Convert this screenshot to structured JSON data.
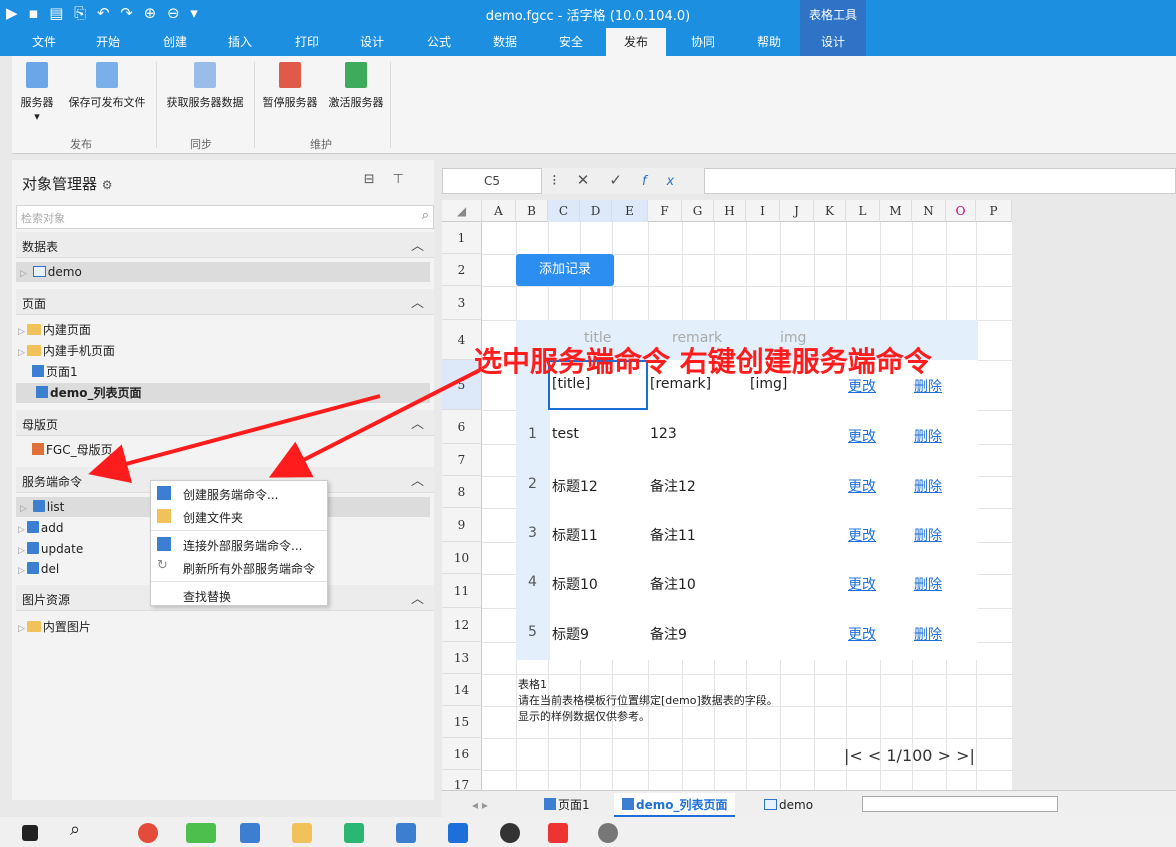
{
  "window": {
    "title": "demo.fgcc - 活字格 (10.0.104.0)",
    "ctx_group": "表格工具"
  },
  "ribbon": {
    "tabs": [
      "文件",
      "开始",
      "创建",
      "插入",
      "打印",
      "设计",
      "公式",
      "数据",
      "安全",
      "发布",
      "协同",
      "帮助"
    ],
    "active_tab": "发布",
    "ctx_tab": "设计",
    "buttons": {
      "server": "服务器",
      "save_publish": "保存可发布文件",
      "fetch": "获取服务器数据",
      "pause": "暂停服务器",
      "activate": "激活服务器"
    },
    "groups": {
      "publish": "发布",
      "sync": "同步",
      "maintain": "维护"
    }
  },
  "object_manager": {
    "title": "对象管理器",
    "search_placeholder": "检索对象",
    "sections": {
      "tables": {
        "label": "数据表",
        "items": [
          "demo"
        ]
      },
      "pages": {
        "label": "页面",
        "items": [
          "内建页面",
          "内建手机页面",
          "页面1",
          "demo_列表页面"
        ]
      },
      "master": {
        "label": "母版页",
        "items": [
          "FGC_母版页"
        ]
      },
      "server_cmd": {
        "label": "服务端命令",
        "items": [
          "list",
          "add",
          "update",
          "del"
        ]
      },
      "images": {
        "label": "图片资源",
        "items": [
          "内置图片"
        ]
      }
    }
  },
  "context_menu": {
    "items": [
      "创建服务端命令...",
      "创建文件夹",
      "连接外部服务端命令...",
      "刷新所有外部服务端命令",
      "查找替换"
    ]
  },
  "formula_bar": {
    "cell_ref": "C5",
    "fx": "fx"
  },
  "sheet": {
    "columns": [
      "A",
      "B",
      "C",
      "D",
      "E",
      "F",
      "G",
      "H",
      "I",
      "J",
      "K",
      "L",
      "M",
      "N",
      "O",
      "P"
    ],
    "rows": [
      "1",
      "2",
      "3",
      "4",
      "5",
      "6",
      "7",
      "8",
      "9",
      "10",
      "11",
      "12",
      "13",
      "14",
      "15",
      "16",
      "17"
    ],
    "add_button": "添加记录",
    "table": {
      "headers": [
        "title",
        "remark",
        "img"
      ],
      "template": [
        "[title]",
        "[remark]",
        "[img]"
      ],
      "edit": "更改",
      "delete": "删除",
      "records": [
        {
          "idx": "1",
          "title": "test",
          "remark": "123"
        },
        {
          "idx": "2",
          "title": "标题12",
          "remark": "备注12"
        },
        {
          "idx": "3",
          "title": "标题11",
          "remark": "备注11"
        },
        {
          "idx": "4",
          "title": "标题10",
          "remark": "备注10"
        },
        {
          "idx": "5",
          "title": "标题9",
          "remark": "备注9"
        }
      ],
      "note_lines": [
        "表格1",
        "请在当前表格模板行位置绑定[demo]数据表的字段。",
        "显示的样例数据仅供参考。"
      ],
      "pager": "|< < 1/100 > >|"
    },
    "tabs": [
      "页面1",
      "demo_列表页面",
      "demo"
    ]
  },
  "annotation": "选中服务端命令 右键创建服务端命令",
  "colors": {
    "accent": "#1d8fe0",
    "annotation": "#ff1c1c",
    "link": "#1d6fd9"
  }
}
